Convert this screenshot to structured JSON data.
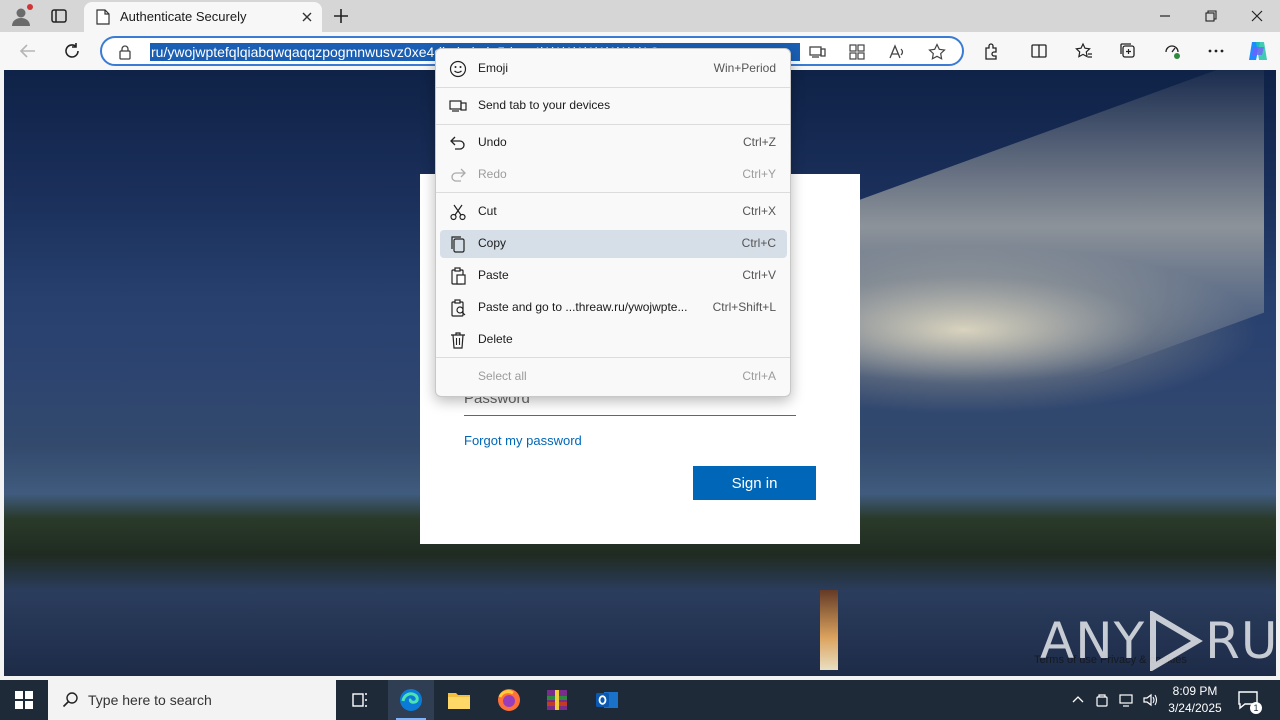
{
  "browser": {
    "tab_title": "Authenticate Securely",
    "url_text": "ru/ywojwptefqlqiabqwqaqqzpogmnwusvz0xe4dbxkakaln5dmo4l1l1l1l1l1l1l1l1l1l1C",
    "icons": {
      "profile": "profile-icon",
      "favorites": "star-icon",
      "read_aloud": "read-aloud-icon",
      "copilot": "copilot-icon"
    }
  },
  "page": {
    "password_placeholder": "Password",
    "forgot_link": "Forgot my password",
    "signin_label": "Sign in",
    "footer_links": "Terms of use   Privacy & cookies",
    "watermark_left": "ANY",
    "watermark_right": "RUN"
  },
  "context_menu": {
    "items": [
      {
        "label": "Emoji",
        "shortcut": "Win+Period",
        "icon": "emoji-icon",
        "enabled": true
      },
      {
        "label": "Send tab to your devices",
        "shortcut": "",
        "icon": "send-tab-icon",
        "enabled": true
      },
      {
        "label": "Undo",
        "shortcut": "Ctrl+Z",
        "icon": "undo-icon",
        "enabled": true
      },
      {
        "label": "Redo",
        "shortcut": "Ctrl+Y",
        "icon": "redo-icon",
        "enabled": false
      },
      {
        "label": "Cut",
        "shortcut": "Ctrl+X",
        "icon": "cut-icon",
        "enabled": true
      },
      {
        "label": "Copy",
        "shortcut": "Ctrl+C",
        "icon": "copy-icon",
        "enabled": true,
        "highlighted": true
      },
      {
        "label": "Paste",
        "shortcut": "Ctrl+V",
        "icon": "paste-icon",
        "enabled": true
      },
      {
        "label": "Paste and go to ...threaw.ru/ywojwpte...",
        "shortcut": "Ctrl+Shift+L",
        "icon": "paste-go-icon",
        "enabled": true
      },
      {
        "label": "Delete",
        "shortcut": "",
        "icon": "delete-icon",
        "enabled": true
      },
      {
        "label": "Select all",
        "shortcut": "Ctrl+A",
        "icon": "",
        "enabled": false
      }
    ]
  },
  "taskbar": {
    "search_placeholder": "Type here to search",
    "time": "8:09 PM",
    "date": "3/24/2025",
    "notification_count": "1",
    "apps": [
      "task-view-icon",
      "edge-icon",
      "file-explorer-icon",
      "firefox-icon",
      "winrar-icon",
      "outlook-icon"
    ]
  },
  "colors": {
    "accent": "#0067b8",
    "url_selection": "#1a5fb4",
    "menu_highlight": "#d6dfe8",
    "taskbar": "#1f2a38"
  }
}
